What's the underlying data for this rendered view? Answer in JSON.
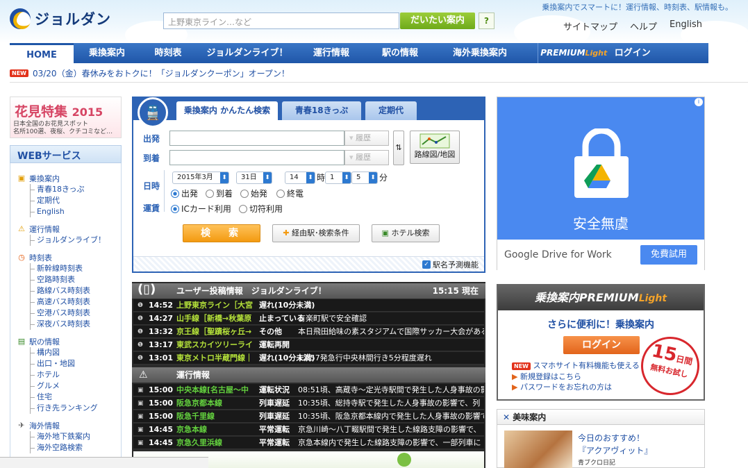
{
  "header": {
    "logo": "ジョルダン",
    "search_placeholder": "上野東京ライン…など",
    "search_button": "だいたい案内",
    "help_button": "?",
    "tagline": "乗換案内でスマートに！運行情報、時刻表、駅情報も。",
    "links": [
      "サイトマップ",
      "ヘルプ",
      "English"
    ]
  },
  "nav": {
    "items": [
      "HOME",
      "乗換案内",
      "時刻表",
      "ジョルダンライブ！",
      "運行情報",
      "駅の情報",
      "海外乗換案内"
    ],
    "premium_logo": "PREMIUM",
    "premium_light": "Light",
    "login": "ログイン"
  },
  "news": {
    "badge": "NEW",
    "text": "03/20（金）春休みをおトクに！「ジョルダンクーポン」オープン！"
  },
  "sidebar": {
    "banner_title": "花見特集",
    "banner_year": "2015",
    "banner_line1": "日本全国のお花見スポット",
    "banner_line2": "名所100選、夜桜、クチコミなど…",
    "web_services": "WEBサービス",
    "groups": [
      {
        "icon": "train-icon",
        "title": "乗換案内",
        "items": [
          "青春18きっぷ",
          "定期代",
          "English"
        ]
      },
      {
        "icon": "warning-icon",
        "title": "運行情報",
        "items": [
          "ジョルダンライブ！"
        ]
      },
      {
        "icon": "clock-icon",
        "title": "時刻表",
        "items": [
          "新幹線時刻表",
          "空路時刻表",
          "路線バス時刻表",
          "高速バス時刻表",
          "空港バス時刻表",
          "深夜バス時刻表"
        ]
      },
      {
        "icon": "station-icon",
        "title": "駅の情報",
        "items": [
          "構内図",
          "出口・地図",
          "ホテル",
          "グルメ",
          "住宅",
          "行き先ランキング"
        ]
      },
      {
        "icon": "plane-icon",
        "title": "海外情報",
        "items": [
          "海外地下鉄案内",
          "海外空路検索"
        ]
      }
    ]
  },
  "search": {
    "tabs": [
      "乗換案内 かんたん検索",
      "青春18きっぷ",
      "定期代"
    ],
    "from_label": "出発",
    "to_label": "到着",
    "history": "履歴",
    "route_map": "路線図/地図",
    "datetime_label": "日時",
    "year_month": "2015年3月",
    "day": "31日",
    "hour": "14",
    "hour_unit": "時",
    "min1": "1",
    "min2": "5",
    "min_unit": "分",
    "time_options": [
      "出発",
      "到着",
      "始発",
      "終電"
    ],
    "fare_label": "運賃",
    "fare_options": [
      "ICカード利用",
      "切符利用"
    ],
    "search_button": "検　索",
    "via_button": "経由駅･検索条件",
    "hotel_button": "ホテル検索",
    "predict": "駅名予測機能"
  },
  "live": {
    "title": "ユーザー投稿情報　ジョルダンライブ！",
    "time": "15:15 現在",
    "rows": [
      {
        "time": "14:52",
        "line": "上野東京ライン［大宮",
        "status": "遅れ(10分未満)",
        "msg": ""
      },
      {
        "time": "14:27",
        "line": "山手線［新橋→秋葉原",
        "status": "止まっている",
        "msg": "有楽町駅で安全確認"
      },
      {
        "time": "13:32",
        "line": "京王線［聖蹟桜ヶ丘→",
        "status": "その他",
        "msg": "本日飛田給味の素スタジアムで国際サッカー大会がある"
      },
      {
        "time": "13:17",
        "line": "東武スカイツリーライ",
        "status": "運転再開",
        "msg": ""
      },
      {
        "time": "13:01",
        "line": "東京メトロ半蔵門線｜",
        "status": "遅れ(10分未満)",
        "msg": "12:57発急行中央林間行き5分程度遅れ"
      }
    ],
    "ops_title": "運行情報",
    "ops_rows": [
      {
        "time": "15:00",
        "line": "中央本線[名古屋〜中",
        "status": "運転状況",
        "msg": "08:51頃、高蔵寺〜定光寺駅間で発生した人身事故の影"
      },
      {
        "time": "15:00",
        "line": "阪急京都本線",
        "status": "列車遅延",
        "msg": "10:35頃、総持寺駅で発生した人身事故の影響で、列"
      },
      {
        "time": "15:00",
        "line": "阪急千里線",
        "status": "列車遅延",
        "msg": "10:35頃、阪急京都本線内で発生した人身事故の影響で"
      },
      {
        "time": "14:45",
        "line": "京急本線",
        "status": "平常運転",
        "msg": "京急川崎〜八丁畷駅間で発生した線路支障の影響で、"
      },
      {
        "time": "14:45",
        "line": "京急久里浜線",
        "status": "平常運転",
        "msg": "京急本線内で発生した線路支障の影響で、一部列車に"
      }
    ]
  },
  "ad": {
    "headline": "安全無虞",
    "product": "Google Drive for Work",
    "cta": "免費試用",
    "info": "i",
    "close": "✕"
  },
  "premium": {
    "title": "乗換案内PREMIUM",
    "light": "Light",
    "tagline": "さらに便利に！乗換案内",
    "login": "ログイン",
    "badge": "NEW",
    "links": [
      "スマホサイト有料機能も使える",
      "新規登録はこちら",
      "パスワードをお忘れの方は"
    ],
    "stamp_big": "15",
    "stamp_unit": "日間",
    "stamp_sub": "無料お試し"
  },
  "gourmet": {
    "title": "美味案内",
    "pick": "今日のおすすめ！",
    "name": "『アクアヴィット』",
    "source": "青ブクロ日記"
  }
}
